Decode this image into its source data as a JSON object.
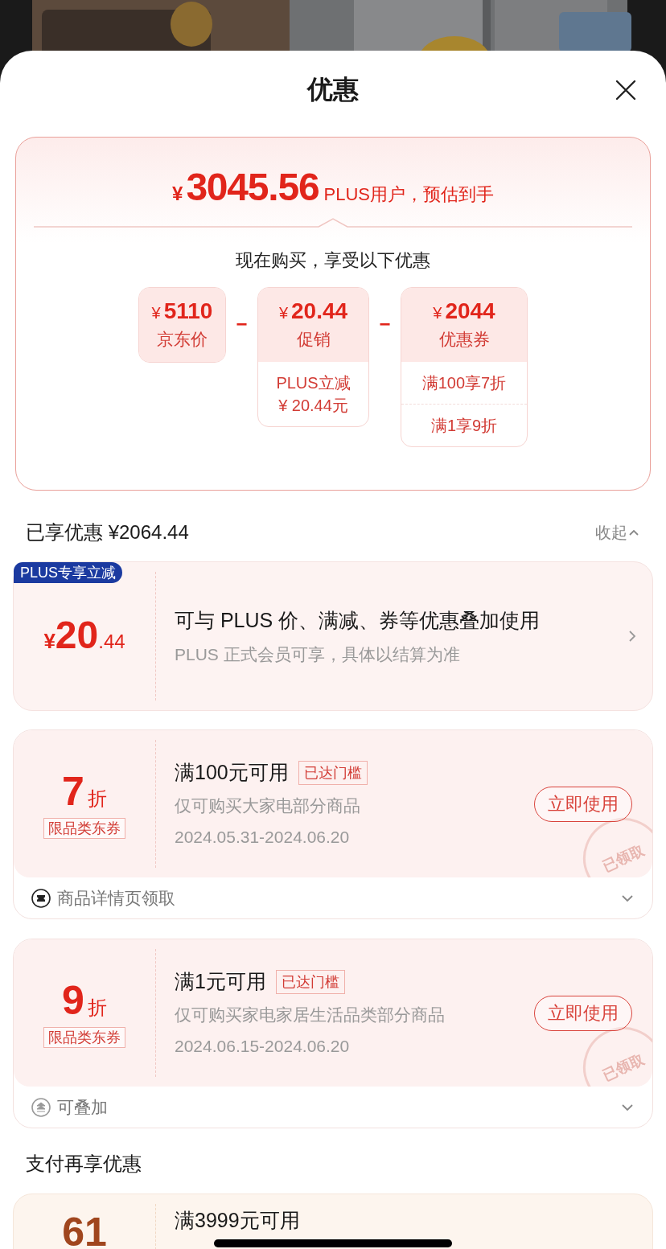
{
  "sheet": {
    "title": "优惠"
  },
  "summary": {
    "currency": "¥",
    "price": "3045.56",
    "price_note": "PLUS用户，预估到手",
    "subtitle": "现在购买，享受以下优惠",
    "breakdown": [
      {
        "currency": "¥",
        "amount": "5110",
        "label": "京东价"
      },
      {
        "operator": "−",
        "currency": "¥",
        "amount": "20.44",
        "label": "促销",
        "details": [
          {
            "text": "PLUS立减",
            "amount": "¥ 20.44元"
          }
        ]
      },
      {
        "operator": "−",
        "currency": "¥",
        "amount": "2044",
        "label": "优惠券",
        "details": [
          {
            "text": "满100享7折"
          },
          {
            "text": "满1享9折"
          }
        ]
      }
    ]
  },
  "enjoyed": {
    "title": "已享优惠 ¥2064.44",
    "toggle": "收起",
    "expanded": true
  },
  "plus_card": {
    "badge": "PLUS专享立减",
    "currency": "¥",
    "amount": "20",
    "decimals": ".44",
    "title": "可与 PLUS 价、满减、券等优惠叠加使用",
    "subtitle": "PLUS 正式会员可享，具体以结算为准"
  },
  "coupons": [
    {
      "discount": "7",
      "unit": "折",
      "tag": "限品类东券",
      "title": "满100元可用",
      "badge": "已达门槛",
      "desc": "仅可购买大家电部分商品",
      "dates": "2024.05.31-2024.06.20",
      "action": "立即使用",
      "stamp": "已领取",
      "footer": "商品详情页领取"
    },
    {
      "discount": "9",
      "unit": "折",
      "tag": "限品类东券",
      "title": "满1元可用",
      "badge": "已达门槛",
      "desc": "仅可购买家电家居生活品类部分商品",
      "dates": "2024.06.15-2024.06.20",
      "action": "立即使用",
      "stamp": "已领取",
      "footer": "可叠加"
    }
  ],
  "payment": {
    "title": "支付再享优惠",
    "card": {
      "value": "61",
      "title": "满3999元可用"
    }
  }
}
